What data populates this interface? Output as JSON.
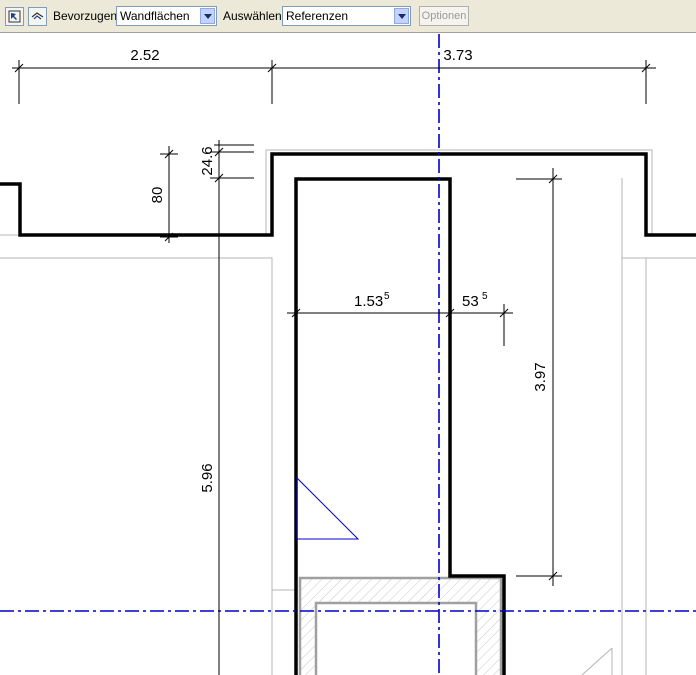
{
  "toolbar": {
    "prefer_label": "Bevorzugen:",
    "prefer_value": "Wandflächen",
    "select_label": "Auswählen:",
    "select_value": "Referenzen",
    "options_label": "Optionen"
  },
  "dimensions": {
    "d_252": "2.52",
    "d_373": "3.73",
    "d_246": "24.6",
    "d_80": "80",
    "d_1535_main": "1.53",
    "d_1535_sup": "5",
    "d_535_main": "53",
    "d_535_sup": "5",
    "d_397": "3.97",
    "d_596": "5.96"
  },
  "colors": {
    "toolbar_bg": "#ece9d8",
    "wall": "#000000",
    "axis": "#0000cc",
    "dimension": "#000000",
    "reference": "#b4b4b4",
    "hatch": "#c8c8c8"
  }
}
